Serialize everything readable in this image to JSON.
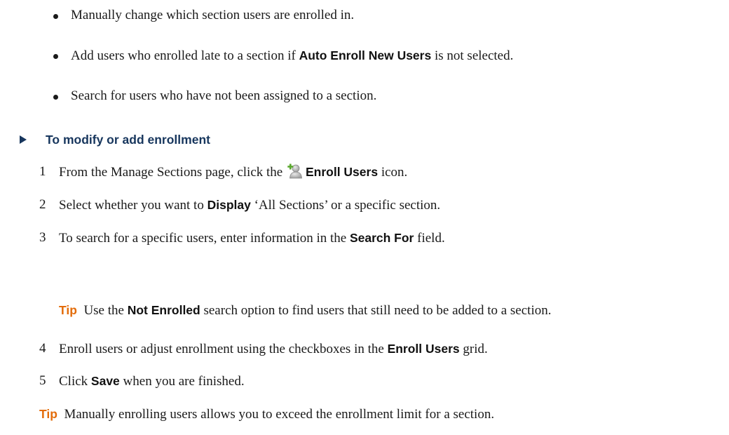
{
  "bullets": [
    {
      "text": "Manually change which section users are enrolled in."
    },
    {
      "before": "Add users who enrolled late to a section if ",
      "bold": "Auto Enroll New Users",
      "after": " is not selected."
    },
    {
      "text": "Search for users who have not been assigned to a section."
    }
  ],
  "procedure": {
    "title": "To modify or add enrollment"
  },
  "steps": [
    {
      "num": "1",
      "before": "From the Manage Sections page, click the ",
      "bold": "Enroll Users",
      "after": " icon.",
      "icon": "enroll-users-icon"
    },
    {
      "num": "2",
      "before": "Select whether you want to ",
      "bold": "Display",
      "after": " ‘All Sections’ or a specific section."
    },
    {
      "num": "3",
      "before": "To search for a specific users, enter information in the ",
      "bold": "Search For",
      "after": " field."
    },
    {
      "num": "4",
      "before": "Enroll users or adjust enrollment using the checkboxes in the ",
      "bold": "Enroll Users",
      "after": " grid."
    },
    {
      "num": "5",
      "before": "Click ",
      "bold": "Save",
      "after": " when you are finished."
    }
  ],
  "tip_inner": {
    "label": "Tip",
    "before": "Use the ",
    "bold": "Not Enrolled",
    "after": " search option to find users that still need to be added to a section."
  },
  "tip_outer": {
    "label": "Tip",
    "text": "Manually enrolling users allows you to exceed the enrollment limit for a section."
  },
  "colors": {
    "heading": "#17365d",
    "tip": "#e36c0a",
    "icon_plus": "#5aa82e",
    "icon_person": "#a9a9a9"
  }
}
